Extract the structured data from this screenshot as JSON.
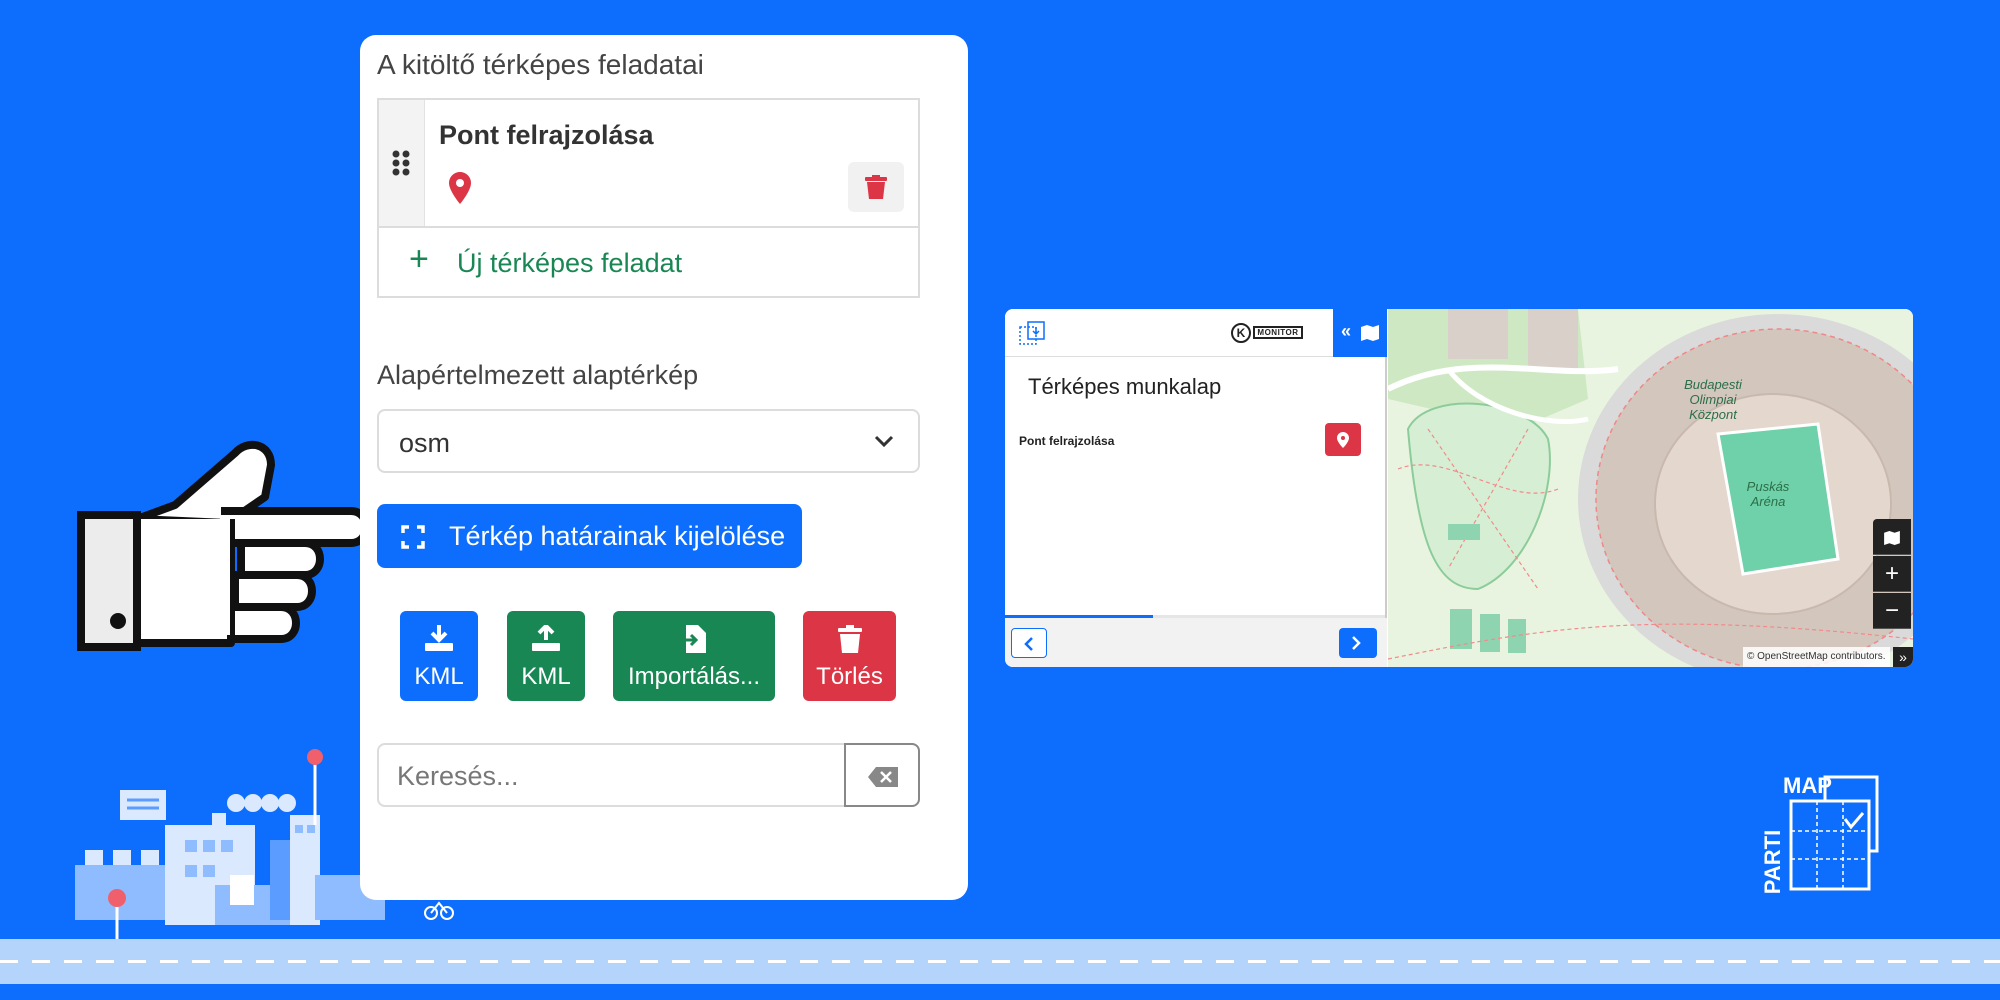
{
  "panel": {
    "title": "A kitöltő térképes feladatai",
    "task": {
      "title": "Pont felrajzolása"
    },
    "new_task_label": "Új térképes feladat",
    "basemap": {
      "label": "Alapértelmezett alaptérkép",
      "value": "osm"
    },
    "bounds_button": "Térkép határainak kijelölése",
    "actions": {
      "kml_download": "KML",
      "kml_upload": "KML",
      "import": "Importálás...",
      "delete": "Törlés"
    },
    "search": {
      "placeholder": "Keresés..."
    }
  },
  "preview": {
    "toggle_label": "«",
    "logo_letter": "K",
    "logo_word": "MONITOR",
    "sheet_title": "Térképes munkalap",
    "task_label": "Pont felrajzolása",
    "progress": 0.39,
    "map": {
      "label_olimpiai": "Budapesti\nOlimpiai\nKözpont",
      "label_arena": "Puskás\nAréna",
      "zoom_in": "+",
      "zoom_out": "−",
      "attribution": "© OpenStreetMap contributors.",
      "expand": "»"
    }
  },
  "brand": {
    "map": "MAP",
    "parti": "PARTI"
  },
  "colors": {
    "background": "#0d6efd",
    "primary": "#0d6efd",
    "success": "#198754",
    "danger": "#dc3545",
    "road": "#b5d4fb"
  }
}
